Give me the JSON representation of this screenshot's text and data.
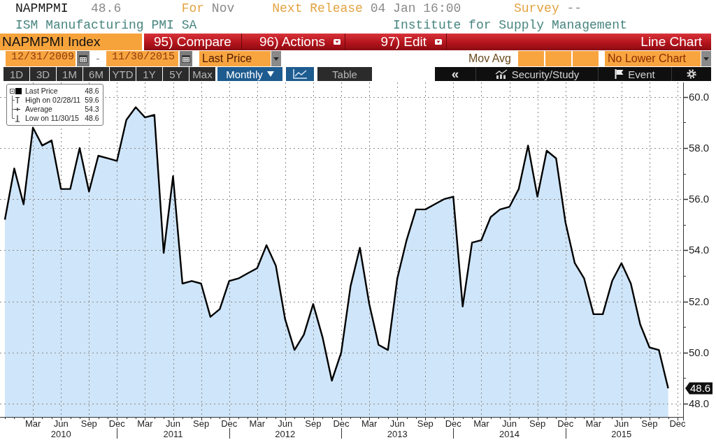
{
  "header": {
    "ticker": "NAPMPMI",
    "value": "48.6",
    "period_label": "For",
    "period": "Nov",
    "release_label": "Next Release",
    "release_time": "04 Jan 16:00",
    "survey_label": "Survey",
    "survey": "--",
    "description": "ISM Manufacturing PMI SA",
    "source": "Institute for Supply Management"
  },
  "title_bar": {
    "security": "NAPMPMI Index",
    "menu": [
      {
        "label": "95) Compare",
        "dropdown": false
      },
      {
        "label": "96) Actions",
        "dropdown": true
      },
      {
        "label": "97) Edit",
        "dropdown": true
      }
    ],
    "chart_type": "Line Chart"
  },
  "range_bar": {
    "start_date": "12/31/2009",
    "separator": "-",
    "end_date": "11/30/2015",
    "field": "Last Price",
    "mov_avg_label": "Mov Avg",
    "lower_chart": "No Lower Chart"
  },
  "toolbar": {
    "periods": [
      {
        "label": "1D",
        "selected": false
      },
      {
        "label": "3D",
        "selected": false
      },
      {
        "label": "1M",
        "selected": false
      },
      {
        "label": "6M",
        "selected": false
      },
      {
        "label": "YTD",
        "selected": false
      },
      {
        "label": "1Y",
        "selected": false
      },
      {
        "label": "5Y",
        "selected": false
      },
      {
        "label": "Max",
        "selected": false
      }
    ],
    "frequency": "Monthly",
    "views": [
      {
        "kind": "chart",
        "selected": true
      },
      {
        "kind": "table",
        "label": "Table",
        "selected": false
      }
    ],
    "tools": [
      {
        "kind": "back",
        "label": "«"
      },
      {
        "kind": "study",
        "label": "Security/Study"
      },
      {
        "kind": "event",
        "label": "Event"
      },
      {
        "kind": "settings"
      }
    ]
  },
  "chart": {
    "legend": [
      {
        "kind": "last",
        "label": "Last Price",
        "value": "48.6"
      },
      {
        "kind": "high",
        "label": "High on 02/28/11",
        "value": "59.6"
      },
      {
        "kind": "average",
        "label": "Average",
        "value": "54.3"
      },
      {
        "kind": "low",
        "label": "Low on 11/30/15",
        "value": "48.6"
      }
    ],
    "last_value_tag": "48.6",
    "year_labels": [
      "2010",
      "2011",
      "2012",
      "2013",
      "2014",
      "2015"
    ],
    "chart_data": {
      "type": "area",
      "grid": true,
      "categories": [
        null,
        null,
        null,
        "Mar",
        null,
        null,
        "Jun",
        null,
        null,
        "Sep",
        null,
        null,
        "Dec",
        null,
        null,
        "Mar",
        null,
        null,
        "Jun",
        null,
        null,
        "Sep",
        null,
        null,
        "Dec",
        null,
        null,
        "Mar",
        null,
        null,
        "Jun",
        null,
        null,
        "Sep",
        null,
        null,
        "Dec",
        null,
        null,
        "Mar",
        null,
        null,
        "Jun",
        null,
        null,
        "Sep",
        null,
        null,
        "Dec",
        null,
        null,
        "Mar",
        null,
        null,
        "Jun",
        null,
        null,
        "Sep",
        null,
        null,
        "Dec",
        null,
        null,
        "Mar",
        null,
        null,
        "Jun",
        null,
        null,
        "Sep",
        null,
        null,
        "Dec"
      ],
      "series": [
        {
          "color": "#000000",
          "values": [
            55.2,
            57.2,
            55.8,
            58.8,
            58.1,
            58.3,
            56.4,
            56.4,
            58.0,
            56.3,
            57.7,
            57.6,
            57.5,
            59.1,
            59.6,
            59.2,
            59.3,
            53.9,
            56.9,
            52.7,
            52.8,
            52.7,
            51.4,
            51.7,
            52.8,
            52.9,
            53.1,
            53.3,
            54.2,
            53.4,
            51.3,
            50.1,
            50.7,
            51.9,
            50.6,
            48.9,
            50.0,
            52.6,
            54.1,
            51.9,
            50.3,
            50.1,
            52.9,
            54.4,
            55.6,
            55.6,
            55.8,
            56.0,
            56.1,
            51.8,
            54.3,
            54.4,
            55.3,
            55.6,
            55.7,
            56.4,
            58.1,
            56.1,
            57.9,
            57.6,
            55.1,
            53.5,
            52.9,
            51.5,
            51.5,
            52.8,
            53.5,
            52.7,
            51.1,
            50.2,
            50.1,
            48.6,
            null
          ]
        }
      ],
      "ylim": [
        47.48,
        60.57
      ],
      "yticks": [
        {
          "value": 48,
          "label": "48.0"
        },
        {
          "value": 50,
          "label": "50.0"
        },
        {
          "value": 52,
          "label": "52.0"
        },
        {
          "value": 54,
          "label": "54.0"
        },
        {
          "value": 56,
          "label": "56.0"
        },
        {
          "value": 58,
          "label": "58.0"
        },
        {
          "value": 60,
          "label": "60.0"
        }
      ]
    }
  }
}
